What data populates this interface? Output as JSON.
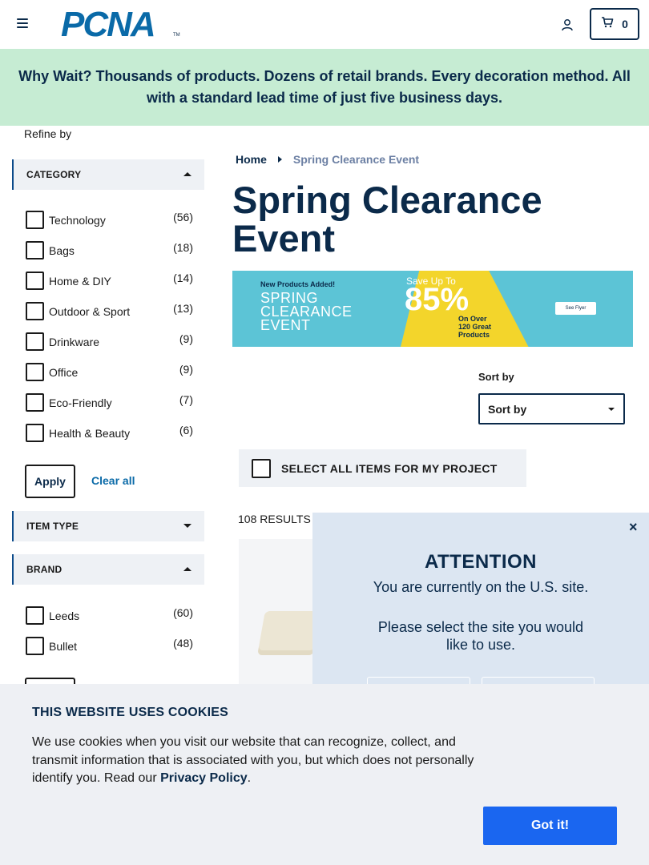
{
  "header": {
    "logo_text": "PCNA",
    "logo_tm": "TM",
    "cart_count": "0"
  },
  "promo": {
    "text": "Why Wait? Thousands of products. Dozens of retail brands. Every decoration method. All with a standard lead time of just five business days."
  },
  "sidebar": {
    "refine_label": "Refine by",
    "category": {
      "title": "CATEGORY",
      "expanded": true,
      "items": [
        {
          "label": "Technology",
          "count": "(56)"
        },
        {
          "label": "Bags",
          "count": "(18)"
        },
        {
          "label": "Home & DIY",
          "count": "(14)"
        },
        {
          "label": "Outdoor & Sport",
          "count": "(13)"
        },
        {
          "label": "Drinkware",
          "count": "(9)"
        },
        {
          "label": "Office",
          "count": "(9)"
        },
        {
          "label": "Eco-Friendly",
          "count": "(7)"
        },
        {
          "label": "Health & Beauty",
          "count": "(6)"
        }
      ],
      "apply_label": "Apply",
      "clear_label": "Clear all"
    },
    "item_type": {
      "title": "ITEM TYPE",
      "expanded": false
    },
    "brand": {
      "title": "BRAND",
      "expanded": true,
      "items": [
        {
          "label": "Leeds",
          "count": "(60)"
        },
        {
          "label": "Bullet",
          "count": "(48)"
        }
      ]
    }
  },
  "main": {
    "breadcrumb": {
      "home": "Home",
      "current": "Spring Clearance Event"
    },
    "title": "Spring Clearance Event",
    "hero": {
      "tag": "New Products Added!",
      "line1": "SPRING",
      "line2": "CLEARANCE",
      "line3": "EVENT",
      "save": "Save Up To",
      "percent": "85%",
      "sub1": "On Over",
      "sub2": "120 Great",
      "sub3": "Products",
      "flyer": "See Flyer"
    },
    "sort": {
      "label": "Sort by",
      "value": "Sort by"
    },
    "select_all": "SELECT ALL ITEMS FOR MY PROJECT",
    "results": "108 RESULTS"
  },
  "attention": {
    "close": "×",
    "title": "ATTENTION",
    "line1": "You are currently on the U.S. site.",
    "line2": "Please select the site you would like to use."
  },
  "cookie": {
    "title": "THIS WEBSITE USES COOKIES",
    "body": "We use cookies when you visit our website that can recognize, collect, and transmit information that is associated with you, but which does not personally identify you. Read our",
    "policy_link": "Privacy Policy",
    "period": ".",
    "button": "Got it!"
  },
  "colors": {
    "navy": "#0b2a4a",
    "brand_blue": "#0a6aa8",
    "promo_bg": "#c6ecd3",
    "facet_bg": "#eef1f5",
    "hero_bg": "#5cc4d6",
    "hero_yellow": "#f3d52b",
    "modal_bg": "#dce6f2",
    "cookie_bg": "#eef0f4",
    "cta_blue": "#1a66f0"
  }
}
